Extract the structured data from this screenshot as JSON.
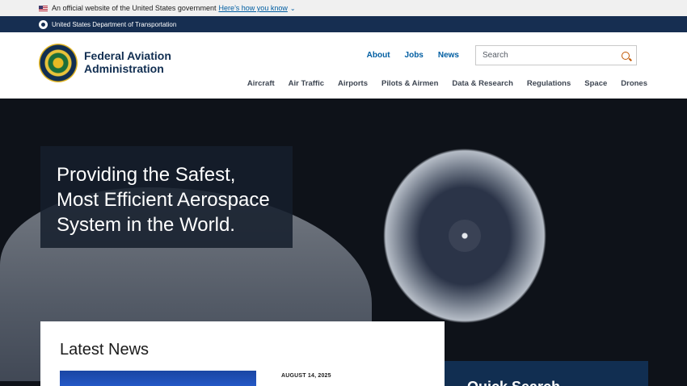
{
  "gov_banner": {
    "text": "An official website of the United States government",
    "link": "Here’s how you know"
  },
  "agency_bar": {
    "text": "United States Department of Transportation"
  },
  "header": {
    "site_name_line1": "Federal Aviation",
    "site_name_line2": "Administration",
    "util_nav": [
      "About",
      "Jobs",
      "News"
    ],
    "search_placeholder": "Search",
    "main_nav": [
      "Aircraft",
      "Air Traffic",
      "Airports",
      "Pilots & Airmen",
      "Data & Research",
      "Regulations",
      "Space",
      "Drones"
    ]
  },
  "hero": {
    "line1": "Providing the Safest,",
    "line2": "Most Efficient Aerospace",
    "line3": "System in the World."
  },
  "latest_news": {
    "title": "Latest News",
    "date": "AUGUST 14, 2025"
  },
  "quick_card": {
    "title": "Quick Search"
  },
  "colors": {
    "navy": "#162e51",
    "link_blue": "#005ea2",
    "search_icon": "#c05600"
  },
  "icons": [
    "us-flag-icon",
    "dot-seal-icon",
    "faa-logo-icon",
    "search-icon",
    "chevron-down-icon"
  ]
}
